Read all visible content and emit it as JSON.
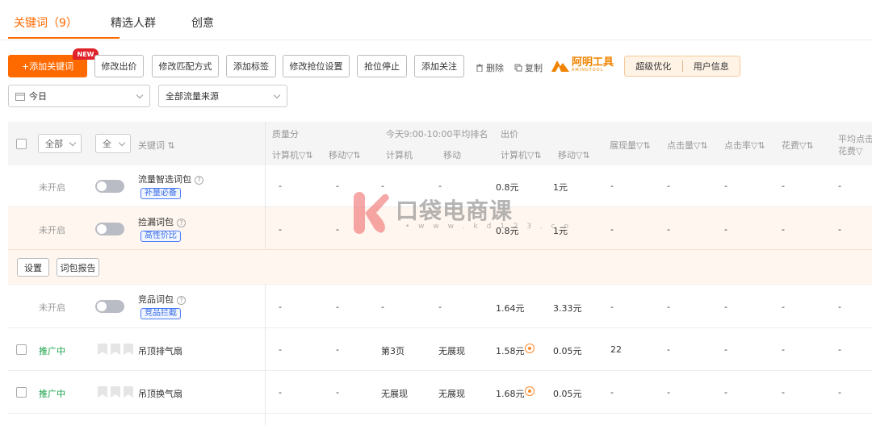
{
  "tabs": [
    {
      "label": "关键词（9）"
    },
    {
      "label": "精选人群"
    },
    {
      "label": "创意"
    }
  ],
  "toolbar": {
    "add_keyword": "+添加关键词",
    "new_badge": "NEW",
    "modify_bid": "修改出价",
    "modify_match": "修改匹配方式",
    "add_tag": "添加标签",
    "modify_grab": "修改抢位设置",
    "stop_grab": "抢位停止",
    "add_follow": "添加关注",
    "delete": "删除",
    "copy": "复制",
    "logo_text": "阿明工具",
    "logo_sub": "AMINGTOOL",
    "super_optimize": "超级优化",
    "user_info": "用户信息"
  },
  "filters": {
    "date": "今日",
    "traffic_source": "全部流量来源"
  },
  "table": {
    "header": {
      "all_status": "全部",
      "all_match": "全",
      "keyword": "关键词",
      "quality": "质量分",
      "quality_pc": "计算机",
      "quality_mobile": "移动",
      "avg_rank": "今天9:00-10:00平均排名",
      "rank_pc": "计算机",
      "rank_mobile": "移动",
      "bid": "出价",
      "bid_pc": "计算机",
      "bid_mobile": "移动",
      "impressions": "展现量",
      "clicks": "点击量",
      "ctr": "点击率",
      "cost": "花费",
      "avg_cpc_1": "平均点击",
      "avg_cpc_2": "花费"
    },
    "rows": [
      {
        "status": "未开启",
        "keyword": "流量智选词包",
        "tag": "补量必备",
        "q_pc": "-",
        "q_mobile": "-",
        "r_pc": "-",
        "r_mobile": "-",
        "bid_pc": "0.8元",
        "bid_mobile": "1元",
        "impr": "-",
        "clicks": "-",
        "ctr": "-",
        "cost": "-",
        "cpc": "-"
      },
      {
        "status": "未开启",
        "keyword": "捡漏词包",
        "tag": "高性价比",
        "q_pc": "-",
        "q_mobile": "-",
        "r_pc": "-",
        "r_mobile": "-",
        "bid_pc": "0.8元",
        "bid_mobile": "1元",
        "impr": "-",
        "clicks": "-",
        "ctr": "-",
        "cost": "-",
        "cpc": "-"
      },
      {
        "status": "未开启",
        "keyword": "竞品词包",
        "tag": "竞品拦截",
        "q_pc": "-",
        "q_mobile": "-",
        "r_pc": "-",
        "r_mobile": "-",
        "bid_pc": "1.64元",
        "bid_mobile": "3.33元",
        "impr": "-",
        "clicks": "-",
        "ctr": "-",
        "cost": "-",
        "cpc": "-"
      },
      {
        "status": "推广中",
        "keyword": "吊顶排气扇",
        "q_pc": "-",
        "q_mobile": "-",
        "r_pc": "第3页",
        "r_mobile": "无展现",
        "bid_pc": "1.58元",
        "bid_mobile": "0.05元",
        "impr": "22",
        "clicks": "-",
        "ctr": "-",
        "cost": "-",
        "cpc": "-"
      },
      {
        "status": "推广中",
        "keyword": "吊顶换气扇",
        "q_pc": "-",
        "q_mobile": "-",
        "r_pc": "无展现",
        "r_mobile": "无展现",
        "bid_pc": "1.68元",
        "bid_mobile": "0.05元",
        "impr": "-",
        "clicks": "-",
        "ctr": "-",
        "cost": "-",
        "cpc": "-"
      }
    ],
    "sub_actions": {
      "settings": "设置",
      "report": "词包报告"
    }
  },
  "watermark": {
    "text": "口袋电商课",
    "url": "• w w w . k d 1 2 3 . c n"
  }
}
